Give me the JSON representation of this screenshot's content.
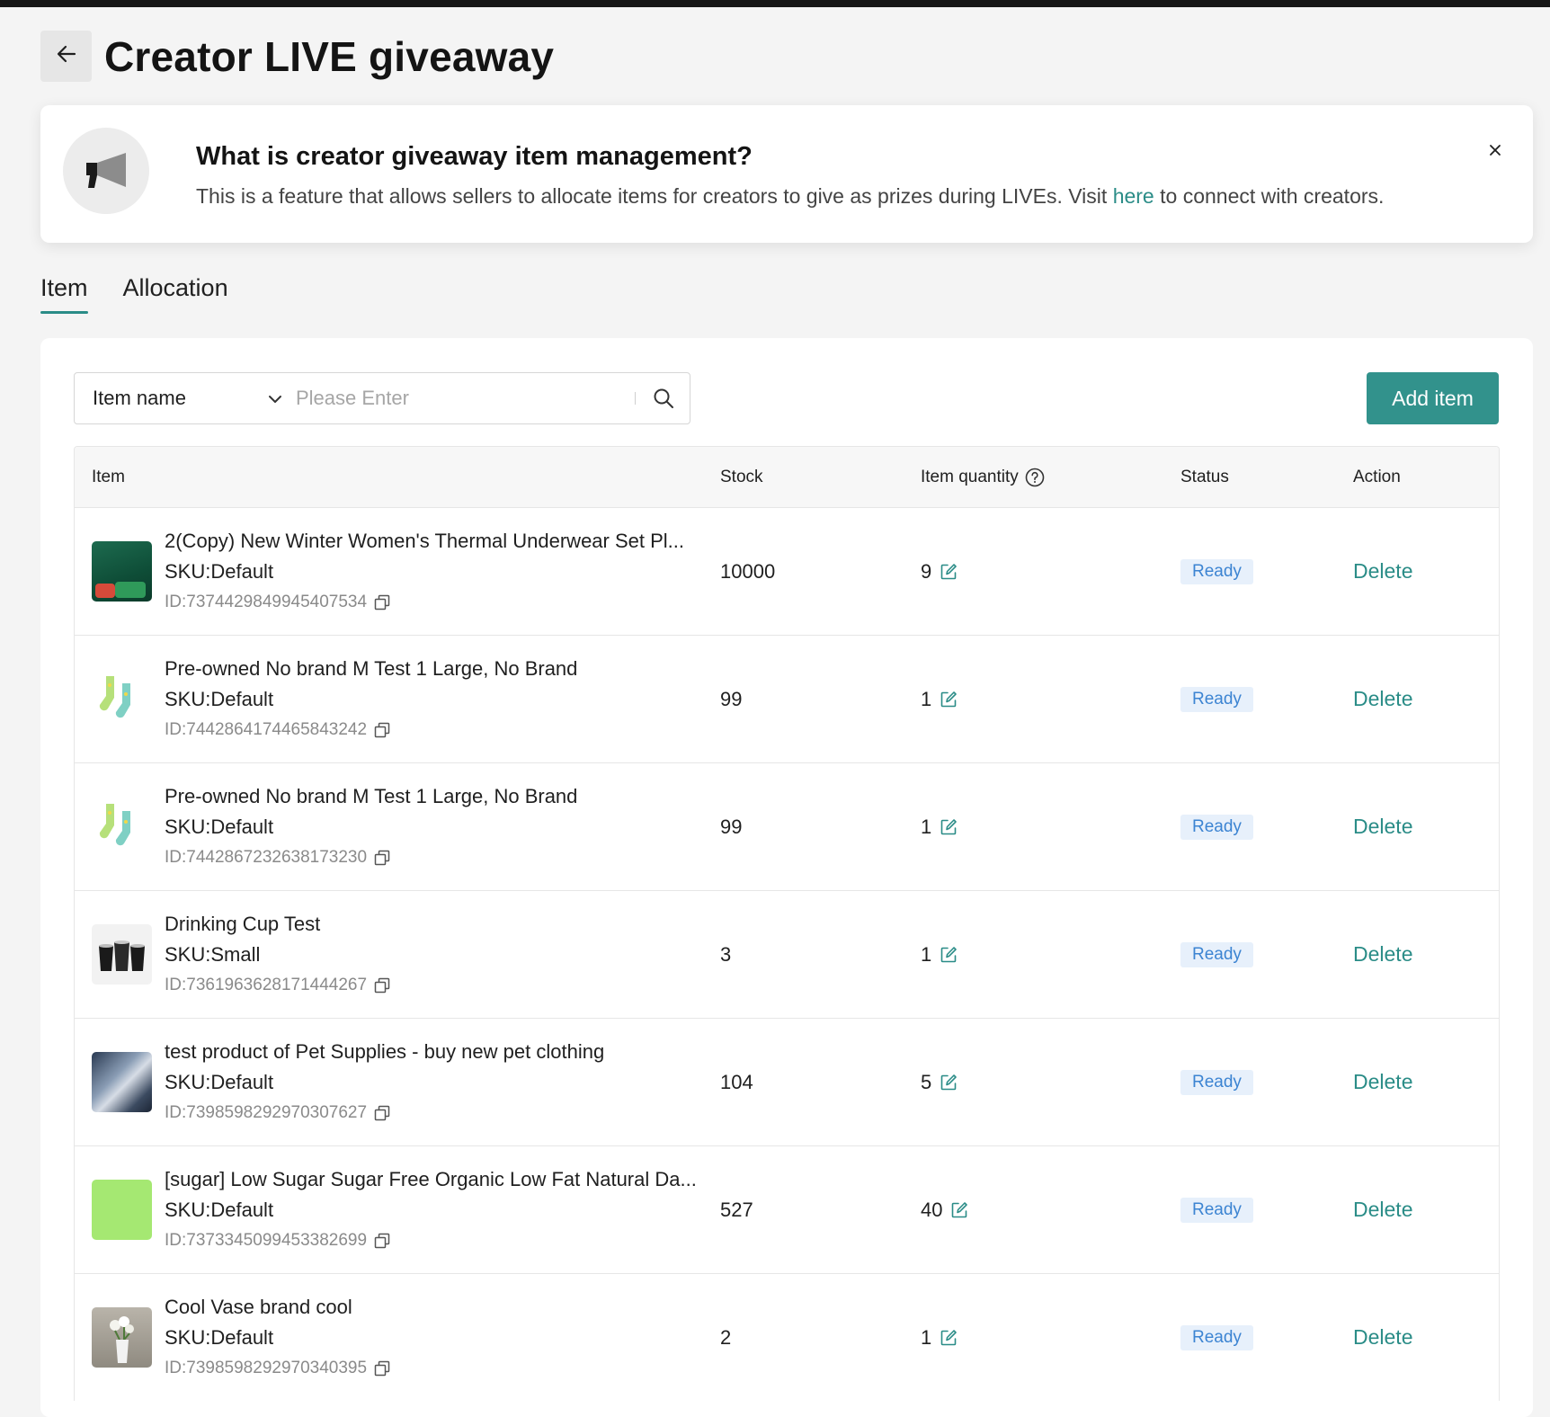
{
  "page": {
    "title": "Creator LIVE giveaway"
  },
  "banner": {
    "title": "What is creator giveaway item management?",
    "desc_before": "This is a feature that allows sellers to allocate items for creators to give as prizes during LIVEs. Visit ",
    "link": "here",
    "desc_after": " to connect with creators."
  },
  "tabs": [
    {
      "label": "Item",
      "active": true
    },
    {
      "label": "Allocation",
      "active": false
    }
  ],
  "search": {
    "field": "Item name",
    "placeholder": "Please Enter"
  },
  "add_button": "Add item",
  "table": {
    "headers": {
      "item": "Item",
      "stock": "Stock",
      "qty": "Item quantity",
      "status": "Status",
      "action": "Action"
    },
    "rows": [
      {
        "name": "2(Copy) New Winter Women's Thermal Underwear Set Pl...",
        "sku": "SKU:Default",
        "id": "ID:7374429849945407534",
        "stock": "10000",
        "qty": "9",
        "status": "Ready",
        "action": "Delete",
        "thumb": "gift-box"
      },
      {
        "name": "Pre-owned No brand M Test 1 Large, No Brand",
        "sku": "SKU:Default",
        "id": "ID:7442864174465843242",
        "stock": "99",
        "qty": "1",
        "status": "Ready",
        "action": "Delete",
        "thumb": "socks"
      },
      {
        "name": "Pre-owned No brand M Test 1 Large, No Brand",
        "sku": "SKU:Default",
        "id": "ID:7442867232638173230",
        "stock": "99",
        "qty": "1",
        "status": "Ready",
        "action": "Delete",
        "thumb": "socks"
      },
      {
        "name": "Drinking Cup Test",
        "sku": "SKU:Small",
        "id": "ID:7361963628171444267",
        "stock": "3",
        "qty": "1",
        "status": "Ready",
        "action": "Delete",
        "thumb": "cups"
      },
      {
        "name": "test product of Pet Supplies - buy new pet clothing",
        "sku": "SKU:Default",
        "id": "ID:7398598292970307627",
        "stock": "104",
        "qty": "5",
        "status": "Ready",
        "action": "Delete",
        "thumb": "photo"
      },
      {
        "name": "[sugar] Low Sugar Sugar Free Organic Low Fat Natural Da...",
        "sku": "SKU:Default",
        "id": "ID:7373345099453382699",
        "stock": "527",
        "qty": "40",
        "status": "Ready",
        "action": "Delete",
        "thumb": "green-swatch"
      },
      {
        "name": "Cool Vase brand cool",
        "sku": "SKU:Default",
        "id": "ID:7398598292970340395",
        "stock": "2",
        "qty": "1",
        "status": "Ready",
        "action": "Delete",
        "thumb": "vase"
      }
    ]
  },
  "colors": {
    "accent": "#2a8c87",
    "button": "#32928c",
    "badge_bg": "#e7f0fb",
    "badge_text": "#3c84d2"
  },
  "icons": [
    "back-arrow-icon",
    "megaphone-icon",
    "close-icon",
    "chevron-down-icon",
    "search-icon",
    "help-icon",
    "copy-icon",
    "edit-icon"
  ]
}
